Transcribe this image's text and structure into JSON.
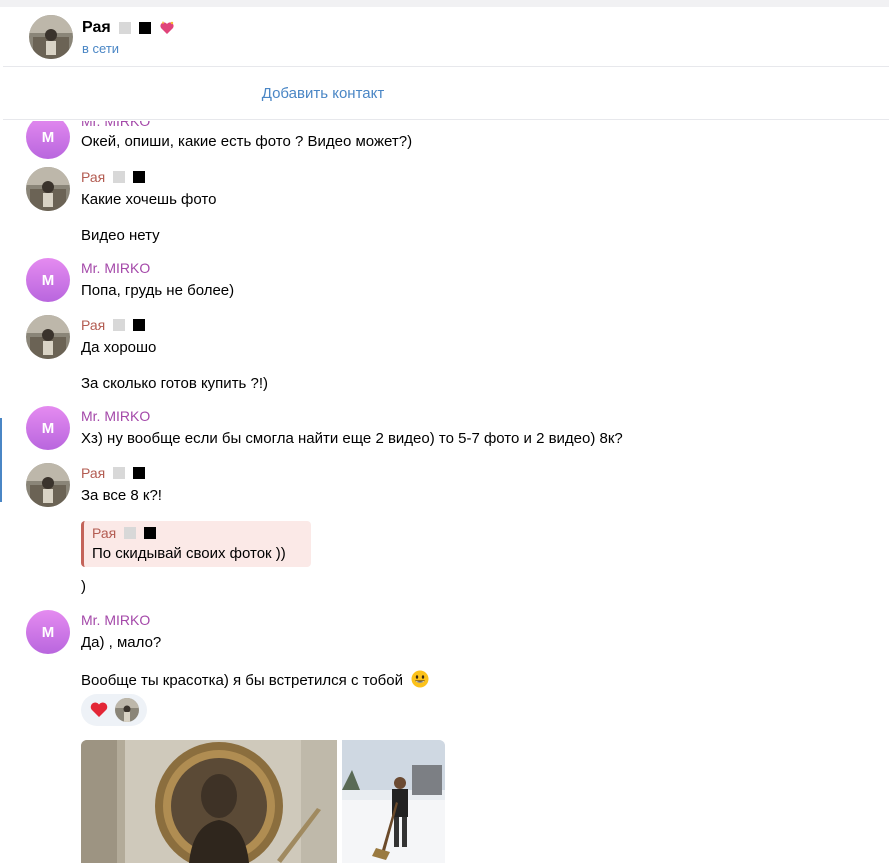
{
  "header": {
    "name": "Рая",
    "status": "в сети"
  },
  "add_contact_label": "Добавить контакт",
  "messages": {
    "m1": {
      "author": "Mr. MIRKO",
      "avatar_letter": "M",
      "lines": [
        "Окей, опиши, какие есть фото ? Видео может?)"
      ]
    },
    "r1": {
      "author": "Рая",
      "lines": [
        "Какие хочешь фото",
        "Видео нету"
      ]
    },
    "m2": {
      "author": "Mr. MIRKO",
      "avatar_letter": "M",
      "lines": [
        "Попа, грудь не более)"
      ]
    },
    "r2": {
      "author": "Рая",
      "lines": [
        "Да хорошо",
        "За сколько готов купить ?!)"
      ]
    },
    "m3": {
      "author": "Mr. MIRKO",
      "avatar_letter": "M",
      "lines": [
        "Хз) ну вообще если бы смогла найти еще 2 видео) то 5-7 фото и 2 видео) 8к?"
      ]
    },
    "r3": {
      "author": "Рая",
      "lines": [
        "За все 8 к?!"
      ],
      "quote": {
        "author": "Рая",
        "text": "По скидывай своих фоток ))"
      },
      "after_quote": ")"
    },
    "m4": {
      "author": "Mr. MIRKO",
      "avatar_letter": "M",
      "lines": [
        "Да) , мало?",
        "Вообще ты красотка) я бы встретился с тобой"
      ]
    }
  },
  "icons": {
    "header_emoji_1": "gray-square",
    "header_emoji_2": "black-square",
    "header_emoji_3": "sparkling-heart",
    "reaction": "red-heart",
    "smiley": "grinning-face"
  },
  "colors": {
    "accent": "#4a86c5",
    "mirko_name": "#a448a9",
    "raya_name": "#b35c52",
    "quote_bg": "#fbe9e7"
  }
}
